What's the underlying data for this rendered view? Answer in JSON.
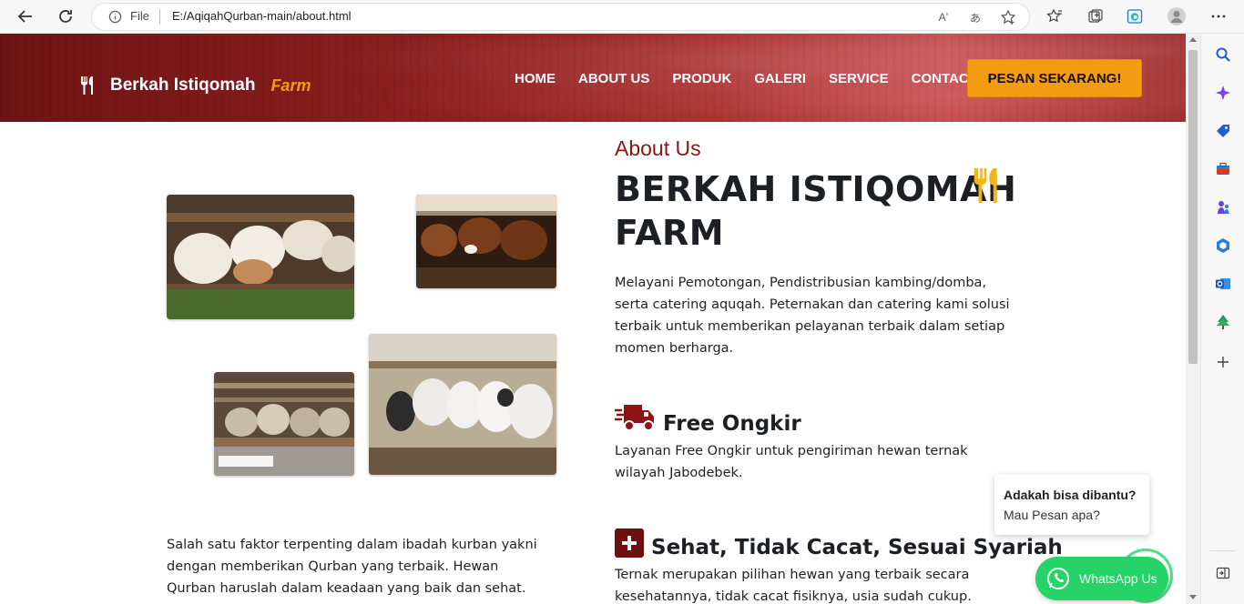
{
  "browser": {
    "file_label": "File",
    "url": "E:/AqiqahQurban-main/about.html",
    "read_aloud_label": "Aʼ",
    "translate_label": "あ"
  },
  "site": {
    "brand_name": "Berkah Istiqomah",
    "brand_sub": "Farm",
    "menu": [
      "HOME",
      "ABOUT US",
      "PRODUK",
      "GALERI",
      "SERVICE",
      "CONTACT"
    ],
    "cta_label": "PESAN SEKARANG!"
  },
  "about": {
    "label": "About Us",
    "title": "BERKAH ISTIQOMAH FARM",
    "description": "Melayani Pemotongan, Pendistribusian kambing/domba, serta catering aquqah. Peternakan dan catering kami solusi terbaik untuk memberikan pelayanan terbaik dalam setiap momen berharga.",
    "left_text": "Salah satu faktor terpenting dalam ibadah kurban yakni dengan memberikan Qurban yang terbaik. Hewan Qurban haruslah dalam keadaan yang baik dan sehat."
  },
  "features": [
    {
      "title": "Free Ongkir",
      "desc": "Layanan Free Ongkir untuk pengiriman hewan ternak wilayah Jabodebek."
    },
    {
      "title": "Sehat, Tidak Cacat, Sesuai Syariah",
      "desc": "Ternak merupakan pilihan hewan yang terbaik secara kesehatannya, tidak cacat fisiknya, usia sudah cukup."
    }
  ],
  "chat": {
    "question": "Adakah bisa dibantu?",
    "subtitle": "Mau Pesan apa?",
    "whatsapp_label": "WhatsApp Us"
  },
  "colors": {
    "accent": "#f39c12",
    "brand_red": "#8c1414",
    "whatsapp": "#25d366"
  }
}
